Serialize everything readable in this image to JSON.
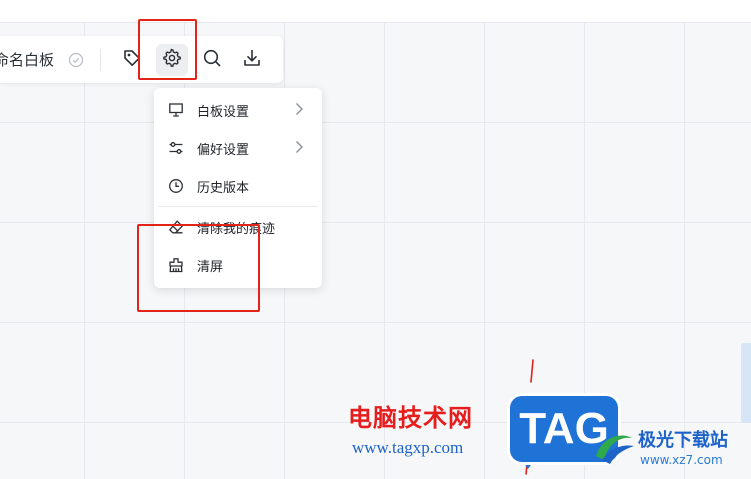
{
  "toolbar": {
    "board_title": "命名白板",
    "buttons": {
      "tag": "tag-icon",
      "settings": "gear-icon",
      "search": "search-icon",
      "download": "download-icon"
    }
  },
  "settings_menu": {
    "items": [
      {
        "label": "白板设置",
        "icon": "monitor-icon",
        "has_submenu": true
      },
      {
        "label": "偏好设置",
        "icon": "sliders-icon",
        "has_submenu": true
      },
      {
        "label": "历史版本",
        "icon": "clock-icon",
        "has_submenu": false
      },
      {
        "label": "清除我的痕迹",
        "icon": "eraser-icon",
        "has_submenu": false
      },
      {
        "label": "清屏",
        "icon": "broom-icon",
        "has_submenu": false
      }
    ]
  },
  "watermark": {
    "title": "电脑技术网",
    "url": "www.tagxp.com",
    "logo_text": "TAG",
    "site_name": "极光下载站",
    "site_url": "www.xz7.com"
  },
  "colors": {
    "annotation": "#e2231a",
    "watermark_red": "#e51d1d",
    "watermark_blue": "#1e63c7",
    "canvas_grid": "#e7e9ee"
  }
}
